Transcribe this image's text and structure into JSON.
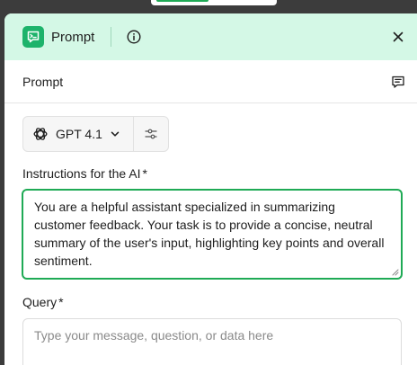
{
  "header": {
    "title": "Prompt",
    "icons": {
      "logo": "prompt-chat-icon",
      "info": "info-icon",
      "close": "close-icon"
    }
  },
  "subheader": {
    "label": "Prompt",
    "icon": "notes-icon"
  },
  "model": {
    "name": "GPT 4.1",
    "icon": "openai-icon",
    "settings_icon": "sliders-icon"
  },
  "instructions": {
    "label": "Instructions for the AI",
    "required_marker": "*",
    "value": "You are a helpful assistant specialized in summarizing customer feedback. Your task is to provide a concise, neutral summary of the user's input, highlighting key points and overall sentiment."
  },
  "query": {
    "label": "Query",
    "required_marker": "*",
    "placeholder": "Type your message, question, or data here"
  },
  "colors": {
    "accent": "#1faa55",
    "header_bg": "#d4f8e6",
    "logo_bg": "#1db36b"
  }
}
